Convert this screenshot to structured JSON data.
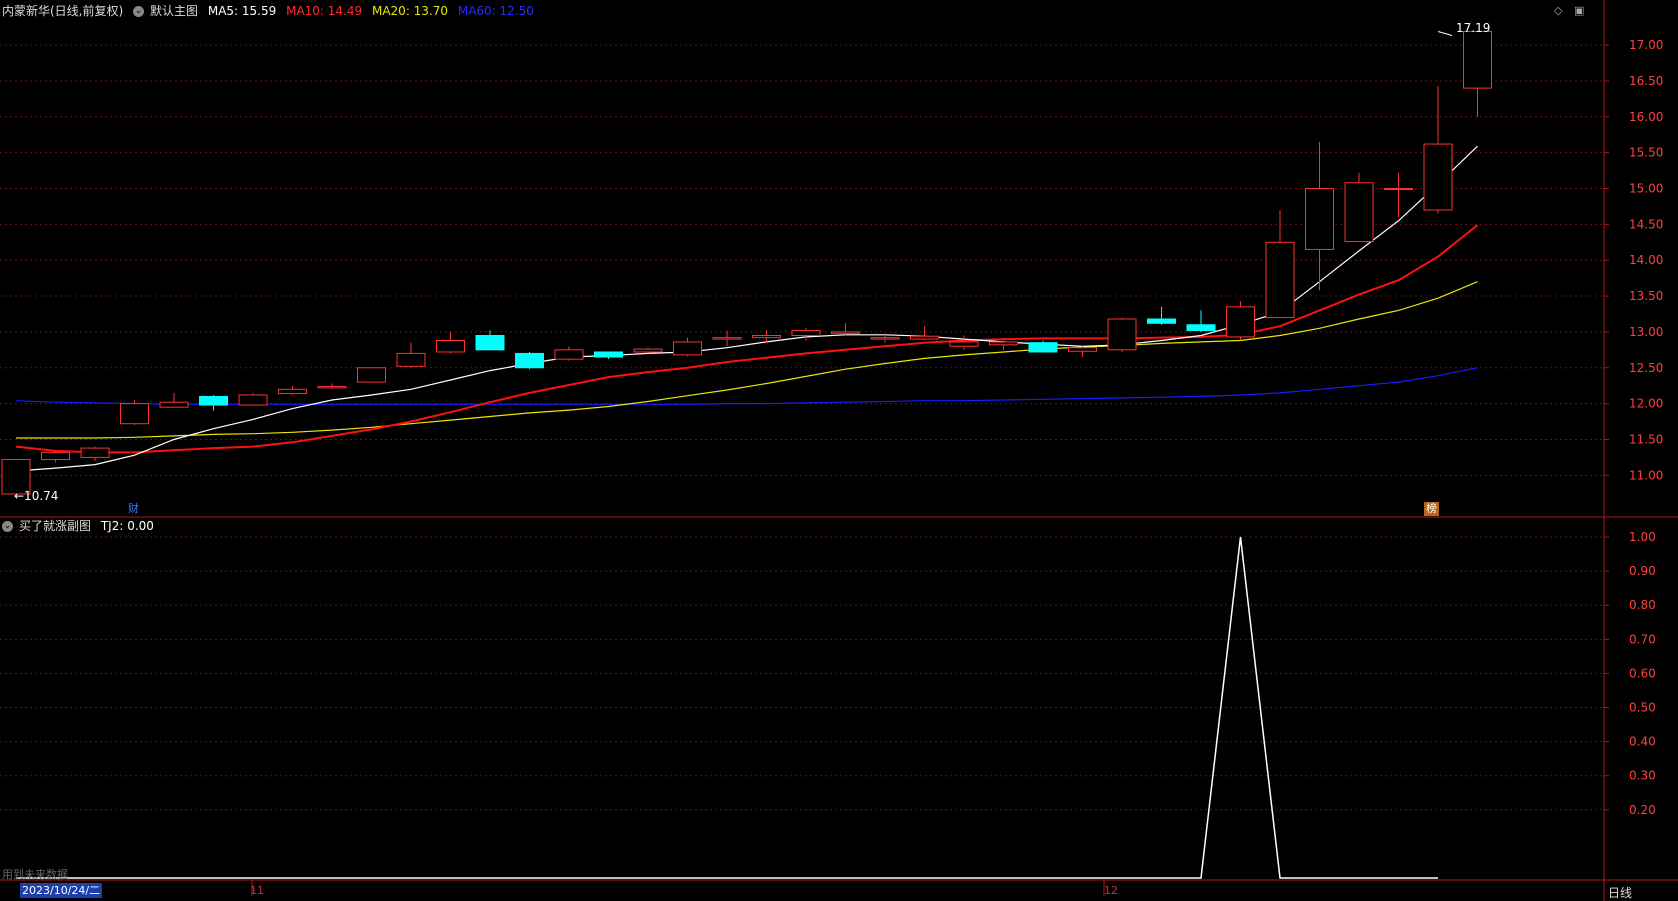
{
  "main_header": {
    "title": "内蒙新华(日线,前复权)",
    "panel": "默认主图",
    "ma5": "MA5: 15.59",
    "ma10": "MA10: 14.49",
    "ma20": "MA20: 13.70",
    "ma60": "MA60: 12.50"
  },
  "sub_header": {
    "panel": "买了就涨副图",
    "tj2": "TJ2: 0.00"
  },
  "markers": {
    "low_label": "←10.74",
    "high_label": "17.19",
    "badge_cai": "财",
    "badge_bang": "榜"
  },
  "footer": {
    "note": "用到未来数据",
    "date": "2023/10/24/二",
    "month_11": "11",
    "month_12": "12",
    "period": "日线"
  },
  "colors": {
    "up": "#ff3030",
    "down": "#00ffff",
    "ma5": "#ffffff",
    "ma10": "#ff1010",
    "ma20": "#e8e800",
    "ma60": "#1a1aff",
    "tj2": "#ffffff",
    "axis": "#b01818"
  },
  "chart_data": [
    {
      "type": "candlestick",
      "title": "内蒙新华(日线,前复权)",
      "ylim": [
        10.6,
        17.35
      ],
      "yticks": [
        "11.00",
        "11.50",
        "12.00",
        "12.50",
        "13.00",
        "13.50",
        "14.00",
        "14.50",
        "15.00",
        "15.50",
        "16.00",
        "16.50",
        "17.00"
      ],
      "x": [
        "c01",
        "c02",
        "c03",
        "c04",
        "c05",
        "c06",
        "c07",
        "c08",
        "c09",
        "c10",
        "c11",
        "c12",
        "c13",
        "c14",
        "c15",
        "c16",
        "c17",
        "c18",
        "c19",
        "c20",
        "c21",
        "c22",
        "c23",
        "c24",
        "c25",
        "c26",
        "c27",
        "c28",
        "c29",
        "c30",
        "c31",
        "c32",
        "c33",
        "c34",
        "c35",
        "c36",
        "c37"
      ],
      "ohlc": [
        [
          10.74,
          11.22,
          10.74,
          11.22
        ],
        [
          11.22,
          11.35,
          11.18,
          11.32
        ],
        [
          11.25,
          11.4,
          11.2,
          11.38
        ],
        [
          11.72,
          12.05,
          11.7,
          12.0
        ],
        [
          11.95,
          12.15,
          11.95,
          12.02
        ],
        [
          12.1,
          12.12,
          11.9,
          11.98
        ],
        [
          11.98,
          12.15,
          11.98,
          12.12
        ],
        [
          12.14,
          12.25,
          12.12,
          12.2
        ],
        [
          12.22,
          12.28,
          12.2,
          12.24
        ],
        [
          12.3,
          12.5,
          12.3,
          12.5
        ],
        [
          12.52,
          12.85,
          12.5,
          12.7
        ],
        [
          12.72,
          13.0,
          12.7,
          12.88
        ],
        [
          12.95,
          13.02,
          12.75,
          12.75
        ],
        [
          12.7,
          12.72,
          12.48,
          12.5
        ],
        [
          12.62,
          12.8,
          12.6,
          12.75
        ],
        [
          12.72,
          12.72,
          12.62,
          12.65
        ],
        [
          12.72,
          12.78,
          12.7,
          12.76
        ],
        [
          12.68,
          12.92,
          12.66,
          12.86
        ],
        [
          12.9,
          13.02,
          12.8,
          12.92
        ],
        [
          12.92,
          13.02,
          12.85,
          12.95
        ],
        [
          12.95,
          13.06,
          12.88,
          13.02
        ],
        [
          12.98,
          13.12,
          12.96,
          13.0
        ],
        [
          12.9,
          12.98,
          12.85,
          12.92
        ],
        [
          12.9,
          13.08,
          12.88,
          12.94
        ],
        [
          12.8,
          12.95,
          12.75,
          12.86
        ],
        [
          12.82,
          12.9,
          12.75,
          12.86
        ],
        [
          12.85,
          12.88,
          12.72,
          12.72
        ],
        [
          12.73,
          12.8,
          12.65,
          12.78
        ],
        [
          12.75,
          13.2,
          12.72,
          13.18
        ],
        [
          13.18,
          13.35,
          13.1,
          13.12
        ],
        [
          13.1,
          13.3,
          13.0,
          13.02
        ],
        [
          12.93,
          13.43,
          12.88,
          13.35
        ],
        [
          13.2,
          14.7,
          13.2,
          14.25
        ],
        [
          14.15,
          15.65,
          13.58,
          15.0
        ],
        [
          14.26,
          15.22,
          14.26,
          15.08
        ],
        [
          15.0,
          15.22,
          14.6,
          15.0
        ],
        [
          14.7,
          16.43,
          14.65,
          15.62
        ],
        [
          16.4,
          17.19,
          16.0,
          17.19
        ]
      ],
      "ma5": [
        11.06,
        11.1,
        11.15,
        11.28,
        11.5,
        11.65,
        11.78,
        11.93,
        12.05,
        12.12,
        12.2,
        12.33,
        12.46,
        12.56,
        12.65,
        12.67,
        12.7,
        12.72,
        12.78,
        12.86,
        12.93,
        12.96,
        12.96,
        12.94,
        12.9,
        12.86,
        12.83,
        12.8,
        12.82,
        12.88,
        12.95,
        13.1,
        13.28,
        13.7,
        14.13,
        14.55,
        15.06,
        15.59
      ],
      "ma10": [
        11.4,
        11.34,
        11.32,
        11.32,
        11.35,
        11.38,
        11.4,
        11.46,
        11.55,
        11.64,
        11.75,
        11.88,
        12.02,
        12.15,
        12.26,
        12.37,
        12.44,
        12.5,
        12.58,
        12.64,
        12.7,
        12.75,
        12.8,
        12.85,
        12.88,
        12.9,
        12.91,
        12.91,
        12.91,
        12.92,
        12.93,
        12.96,
        13.08,
        13.3,
        13.52,
        13.72,
        14.05,
        14.49
      ],
      "ma20": [
        11.52,
        11.52,
        11.52,
        11.53,
        11.55,
        11.57,
        11.58,
        11.6,
        11.63,
        11.67,
        11.72,
        11.77,
        11.82,
        11.87,
        11.91,
        11.96,
        12.03,
        12.11,
        12.19,
        12.28,
        12.38,
        12.48,
        12.56,
        12.63,
        12.68,
        12.72,
        12.76,
        12.79,
        12.81,
        12.84,
        12.86,
        12.88,
        12.95,
        13.05,
        13.18,
        13.3,
        13.47,
        13.7
      ],
      "ma60": [
        12.04,
        12.02,
        12.01,
        12.0,
        11.99,
        11.99,
        11.99,
        11.99,
        11.99,
        11.99,
        11.99,
        11.99,
        11.99,
        11.99,
        11.99,
        11.99,
        11.99,
        11.99,
        12.0,
        12.0,
        12.01,
        12.02,
        12.03,
        12.04,
        12.04,
        12.05,
        12.06,
        12.07,
        12.08,
        12.09,
        12.1,
        12.12,
        12.15,
        12.2,
        12.25,
        12.3,
        12.39,
        12.5
      ]
    },
    {
      "type": "line",
      "title": "买了就涨副图",
      "ylim": [
        0,
        1.05
      ],
      "yticks": [
        "0.20",
        "0.30",
        "0.40",
        "0.50",
        "0.60",
        "0.70",
        "0.80",
        "0.90",
        "1.00"
      ],
      "series": [
        {
          "name": "TJ2",
          "values": [
            0,
            0,
            0,
            0,
            0,
            0,
            0,
            0,
            0,
            0,
            0,
            0,
            0,
            0,
            0,
            0,
            0,
            0,
            0,
            0,
            0,
            0,
            0,
            0,
            0,
            0,
            0,
            0,
            0,
            0,
            0,
            1,
            0,
            0,
            0,
            0,
            0
          ]
        }
      ]
    }
  ]
}
